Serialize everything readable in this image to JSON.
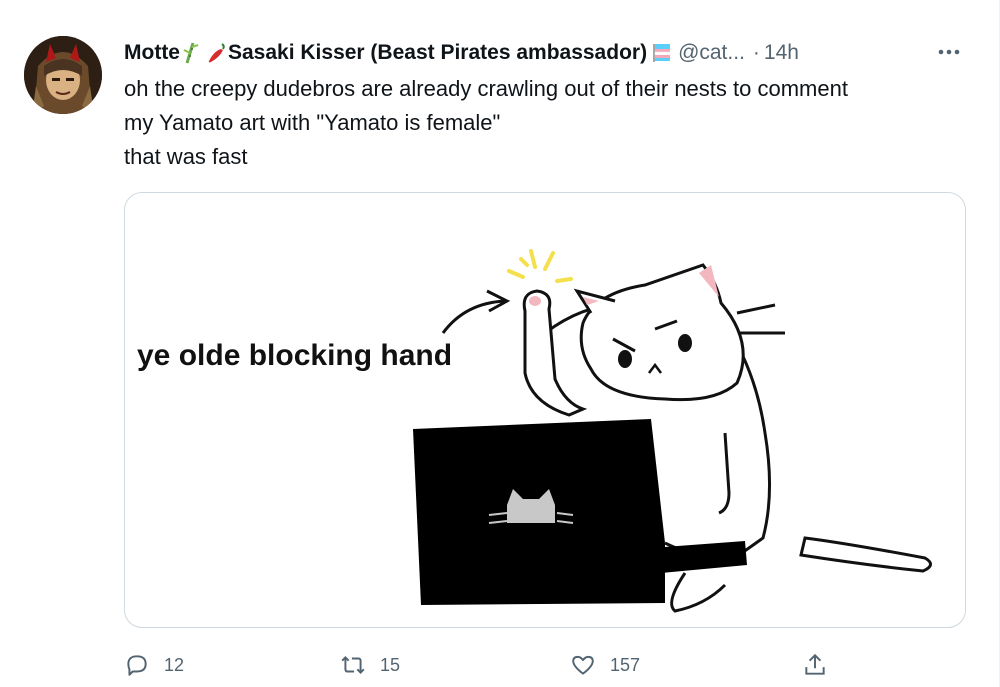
{
  "tweet": {
    "display_name": "Motte",
    "display_name_rest": "Sasaki Kisser (Beast Pirates ambassador)",
    "handle": "@cat...",
    "separator": "·",
    "time": "14h",
    "text_lines": [
      "oh the creepy dudebros are already crawling out of their nests to comment",
      "my Yamato art with \"Yamato is female\"",
      "that was fast"
    ],
    "media": {
      "caption": "ye olde blocking hand"
    },
    "actions": {
      "reply_count": "12",
      "retweet_count": "15",
      "like_count": "157"
    }
  },
  "icons": {
    "more": "more-horizontal-icon",
    "reply": "reply-icon",
    "retweet": "retweet-icon",
    "like": "heart-icon",
    "share": "share-icon"
  },
  "colors": {
    "secondary_text": "#536471",
    "border": "#cfd9de",
    "text": "#0f1419"
  }
}
